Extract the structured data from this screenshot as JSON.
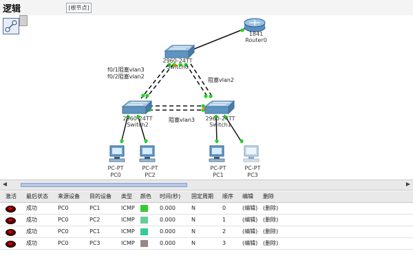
{
  "window": {
    "title": "逻辑",
    "path_label": "[根节点]"
  },
  "devices": {
    "router": {
      "model": "1841",
      "name": "Router0"
    },
    "top_switch": {
      "model": "2960-24TT",
      "name": "Switch0"
    },
    "left_switch": {
      "model": "2960-24TT",
      "name": "Switch2"
    },
    "right_switch": {
      "model": "2960-24TT",
      "name": "Switch1"
    },
    "pcs": [
      {
        "model": "PC-PT",
        "name": "PC0"
      },
      {
        "model": "PC-PT",
        "name": "PC2"
      },
      {
        "model": "PC-PT",
        "name": "PC1"
      },
      {
        "model": "PC-PT",
        "name": "PC3"
      }
    ]
  },
  "annotations": {
    "left_trunk_1": "f0/1阻塞vlan3",
    "left_trunk_2": "f0/2阻塞vlan2",
    "right_trunk": "阻塞vlan2",
    "bottom_trunk": "阻塞vlan3"
  },
  "table": {
    "headers": [
      "激活",
      "最后状态",
      "来源设备",
      "目的设备",
      "类型",
      "颜色",
      "时间(秒)",
      "固定周期",
      "顺序",
      "编辑",
      "删除"
    ],
    "rows": [
      {
        "status": "成功",
        "source": "PC0",
        "dest": "PC1",
        "type": "ICMP",
        "color": "#33cc33",
        "time": "0.000",
        "periodic": "N",
        "num": "0",
        "edit": "(编辑)",
        "delete": "(删除)"
      },
      {
        "status": "成功",
        "source": "PC0",
        "dest": "PC2",
        "type": "ICMP",
        "color": "#66cc99",
        "time": "0.000",
        "periodic": "N",
        "num": "1",
        "edit": "(编辑)",
        "delete": "(删除)"
      },
      {
        "status": "成功",
        "source": "PC0",
        "dest": "PC1",
        "type": "ICMP",
        "color": "#33cc99",
        "time": "0.000",
        "periodic": "N",
        "num": "2",
        "edit": "(编辑)",
        "delete": "(删除)"
      },
      {
        "status": "成功",
        "source": "PC0",
        "dest": "PC3",
        "type": "ICMP",
        "color": "#998888",
        "time": "0.000",
        "periodic": "N",
        "num": "3",
        "edit": "(编辑)",
        "delete": "(删除)"
      }
    ]
  }
}
